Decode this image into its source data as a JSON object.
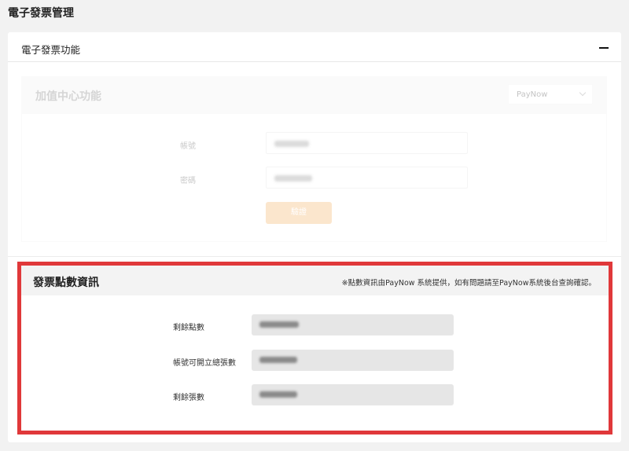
{
  "page": {
    "title": "電子發票管理"
  },
  "card": {
    "title": "電子發票功能"
  },
  "value_added": {
    "title": "加值中心功能",
    "provider_select": {
      "selected": "PayNow"
    },
    "form": {
      "account_label": "帳號",
      "password_label": "密碼",
      "verify_label": "驗證"
    }
  },
  "points": {
    "title": "發票點數資訊",
    "note": "※點數資訊由PayNow 系統提供，如有問題請至PayNow系統後台查詢確認。",
    "rows": [
      {
        "label": "剩餘點數"
      },
      {
        "label": "帳號可開立總張數"
      },
      {
        "label": "剩餘張數"
      }
    ]
  },
  "colors": {
    "highlight_border": "#e0383a",
    "verify_button": "#f5b873"
  }
}
